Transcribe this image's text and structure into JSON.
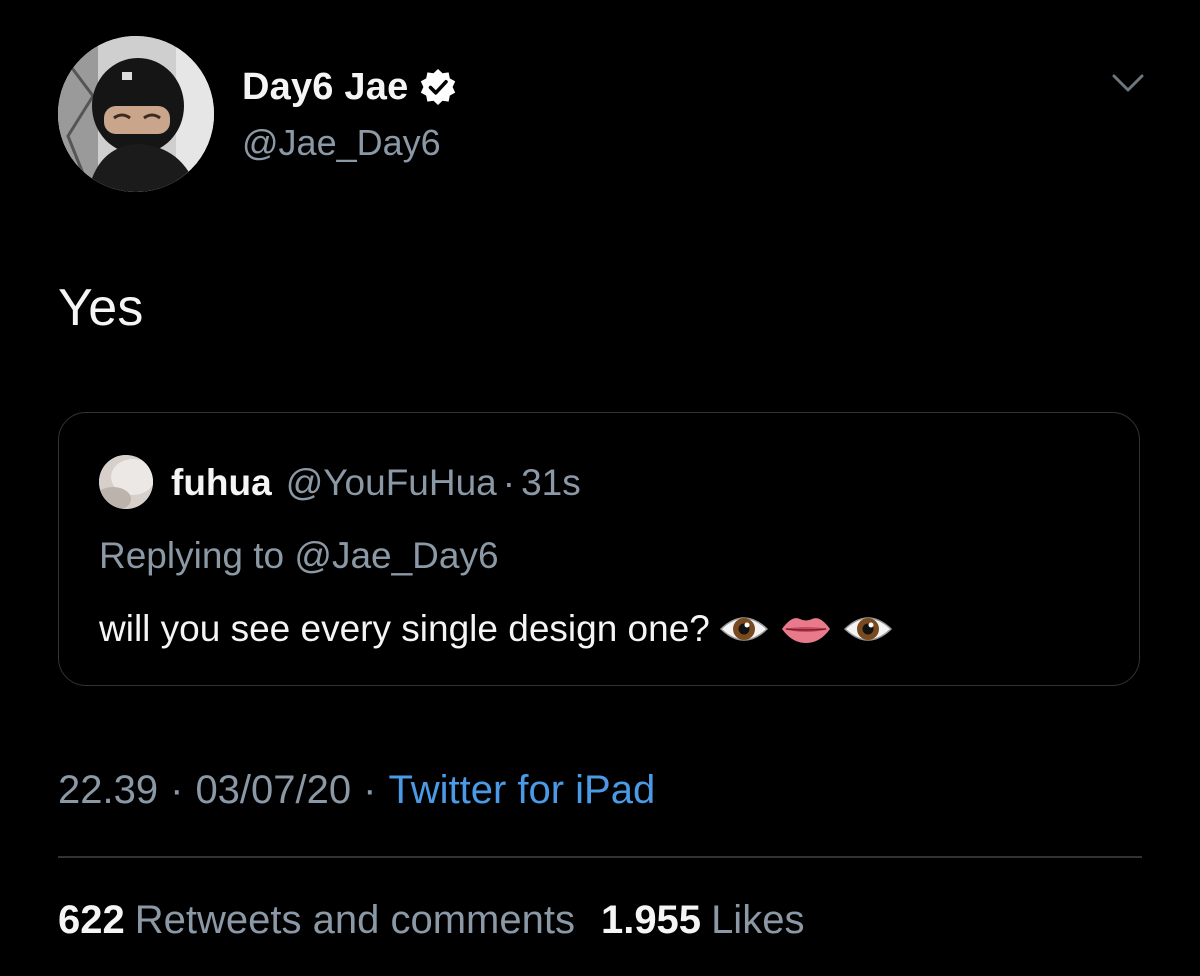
{
  "tweet": {
    "author": {
      "display_name": "Day6 Jae",
      "handle": "@Jae_Day6",
      "verified": true
    },
    "text": "Yes",
    "quoted": {
      "display_name": "fuhua",
      "handle": "@YouFuHua",
      "separator": "·",
      "time": "31s",
      "replying_prefix": "Replying to",
      "replying_handle": "@Jae_Day6",
      "text": "will you see every single design one?",
      "emojis": [
        "eye-icon",
        "lips-icon",
        "eye-icon"
      ]
    },
    "time": "22.39",
    "date": "03/07/20",
    "separator": "·",
    "source": "Twitter for iPad",
    "retweets_count": "622",
    "retweets_label": "Retweets and comments",
    "likes_count": "1.955",
    "likes_label": "Likes"
  },
  "colors": {
    "background": "#000000",
    "primary_text": "#f5f5f5",
    "secondary_text": "#8b98a5",
    "link": "#4a9ae6",
    "border": "#2f3336"
  },
  "icons": {
    "verified": "verified-badge-icon",
    "more": "chevron-down-icon"
  }
}
